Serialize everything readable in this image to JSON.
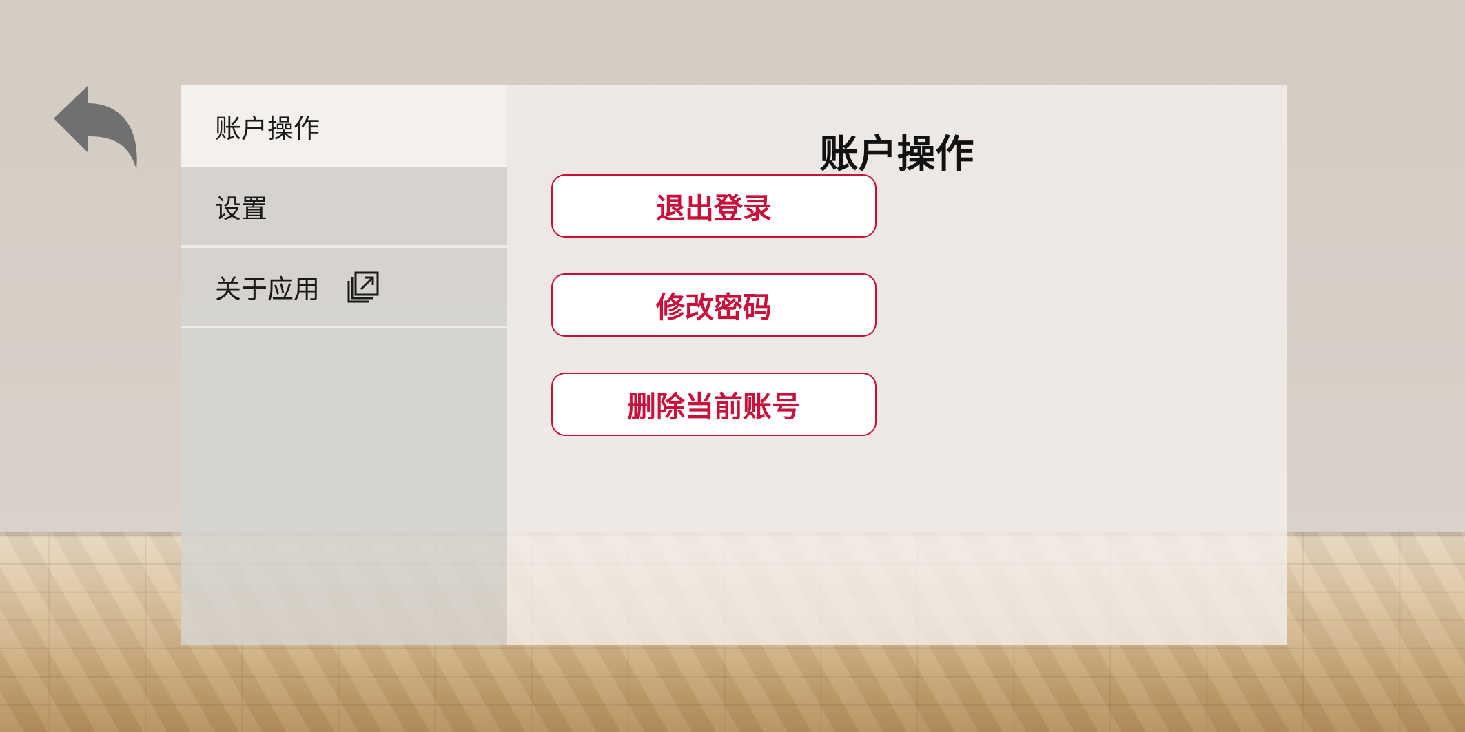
{
  "sidebar": {
    "items": [
      {
        "label": "账户操作",
        "active": true
      },
      {
        "label": "设置",
        "active": false
      },
      {
        "label": "关于应用",
        "active": false,
        "icon": "external-link-icon"
      }
    ]
  },
  "main": {
    "title": "账户操作",
    "actions": [
      {
        "label": "退出登录"
      },
      {
        "label": "修改密码"
      },
      {
        "label": "删除当前账号"
      }
    ]
  },
  "colors": {
    "accent": "#c8103a",
    "back_arrow": "#707070"
  },
  "icons": {
    "back": "back-arrow-icon"
  }
}
